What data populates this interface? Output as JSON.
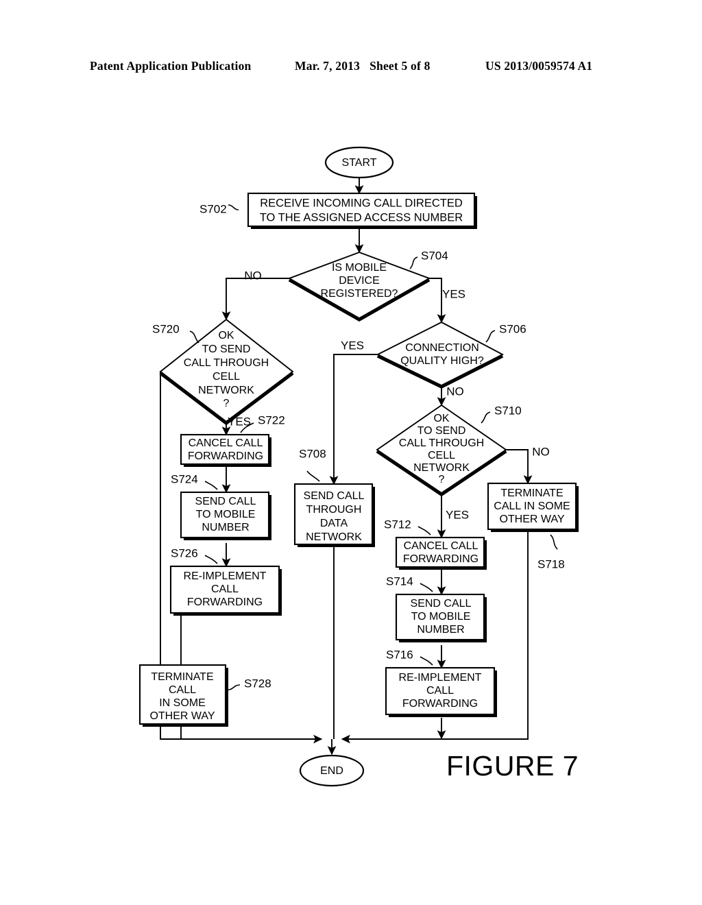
{
  "header": {
    "publication": "Patent Application Publication",
    "date": "Mar. 7, 2013",
    "sheet": "Sheet 5 of 8",
    "patent_number": "US 2013/0059574 A1"
  },
  "figure": {
    "caption": "FIGURE 7"
  },
  "flowchart": {
    "start_label": "START",
    "end_label": "END",
    "nodes": {
      "s702": {
        "ref": "S702",
        "type": "process",
        "lines": [
          "RECEIVE INCOMING CALL DIRECTED",
          "TO THE ASSIGNED ACCESS NUMBER"
        ]
      },
      "s704": {
        "ref": "S704",
        "type": "decision",
        "lines": [
          "IS MOBILE",
          "DEVICE",
          "REGISTERED?"
        ]
      },
      "s706": {
        "ref": "S706",
        "type": "decision",
        "lines": [
          "CONNECTION",
          "QUALITY HIGH?"
        ]
      },
      "s708": {
        "ref": "S708",
        "type": "process",
        "lines": [
          "SEND CALL",
          "THROUGH",
          "DATA",
          "NETWORK"
        ]
      },
      "s710": {
        "ref": "S710",
        "type": "decision",
        "lines": [
          "OK",
          "TO SEND",
          "CALL THROUGH",
          "CELL",
          "NETWORK",
          "?"
        ]
      },
      "s712": {
        "ref": "S712",
        "type": "process",
        "lines": [
          "CANCEL CALL",
          "FORWARDING"
        ]
      },
      "s714": {
        "ref": "S714",
        "type": "process",
        "lines": [
          "SEND CALL",
          "TO MOBILE",
          "NUMBER"
        ]
      },
      "s716": {
        "ref": "S716",
        "type": "process",
        "lines": [
          "RE-IMPLEMENT",
          "CALL",
          "FORWARDING"
        ]
      },
      "s718": {
        "ref": "S718",
        "type": "process",
        "lines": [
          "TERMINATE",
          "CALL IN SOME",
          "OTHER WAY"
        ]
      },
      "s720": {
        "ref": "S720",
        "type": "decision",
        "lines": [
          "OK",
          "TO SEND",
          "CALL THROUGH",
          "CELL",
          "NETWORK",
          "?"
        ]
      },
      "s722": {
        "ref": "S722",
        "type": "process",
        "lines": [
          "CANCEL CALL",
          "FORWARDING"
        ]
      },
      "s724": {
        "ref": "S724",
        "type": "process",
        "lines": [
          "SEND CALL",
          "TO MOBILE",
          "NUMBER"
        ]
      },
      "s726": {
        "ref": "S726",
        "type": "process",
        "lines": [
          "RE-IMPLEMENT",
          "CALL",
          "FORWARDING"
        ]
      },
      "s728": {
        "ref": "S728",
        "type": "process",
        "lines": [
          "TERMINATE",
          "CALL",
          "IN SOME",
          "OTHER WAY"
        ]
      }
    },
    "branch_labels": {
      "s704_no": "NO",
      "s704_yes": "YES",
      "s706_yes": "YES",
      "s706_no": "NO",
      "s710_yes": "YES",
      "s710_no": "NO",
      "s720_yes": "YES"
    }
  }
}
